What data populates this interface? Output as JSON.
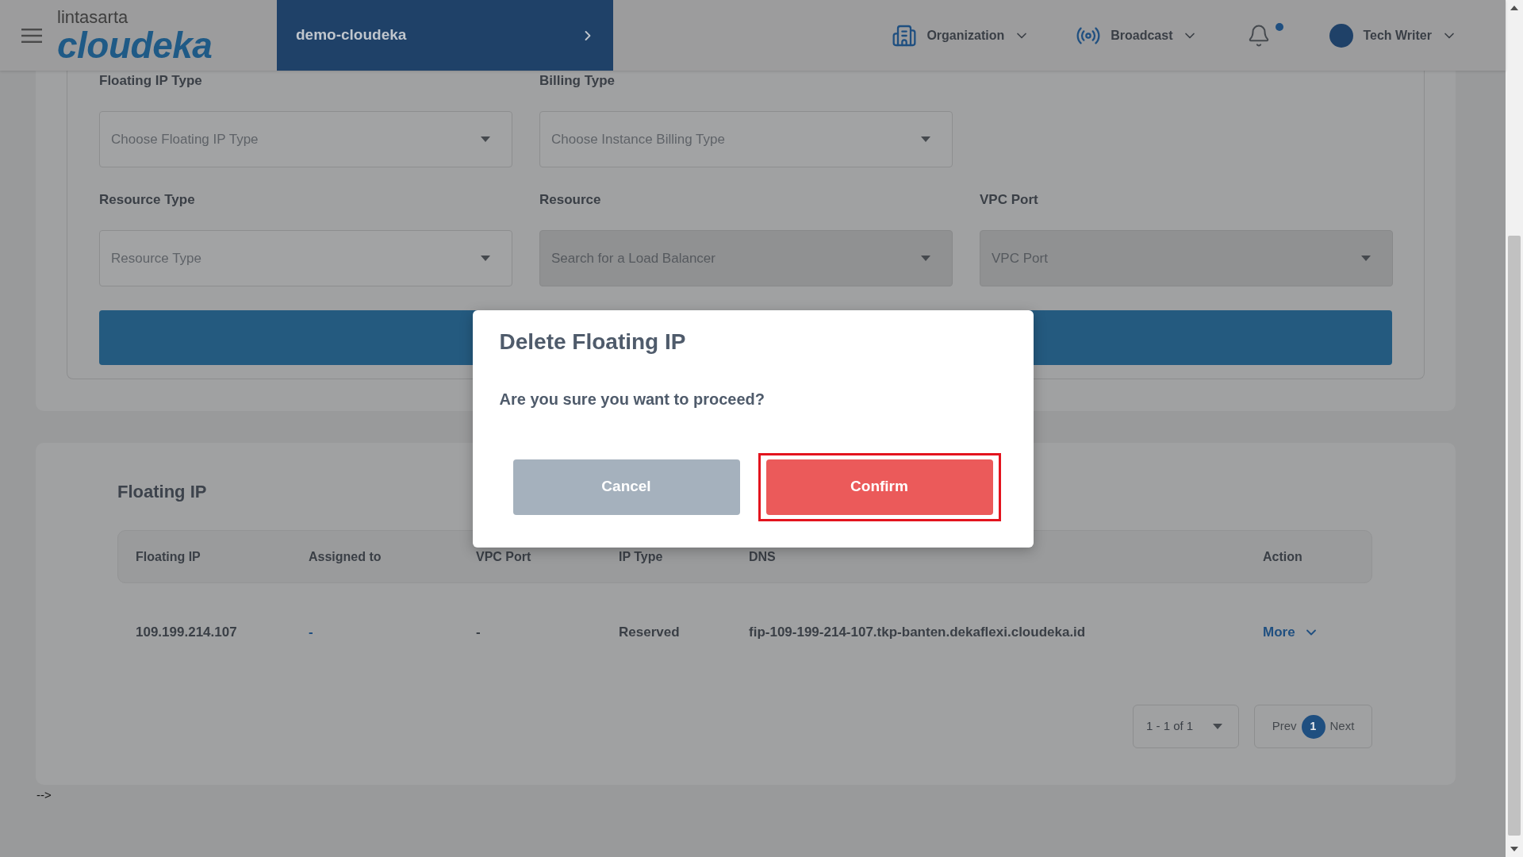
{
  "header": {
    "logo": {
      "company": "lintasarta",
      "product": "cloudeka"
    },
    "project": "demo-cloudeka",
    "menus": [
      {
        "kind": "organization",
        "label": "Organization"
      },
      {
        "kind": "broadcast",
        "label": "Broadcast"
      }
    ],
    "notifications": {
      "unread": true
    },
    "user": {
      "name": "Tech Writer"
    }
  },
  "filter_form": {
    "rows": [
      [
        {
          "label": "Floating IP Type",
          "placeholder": "Choose Floating IP Type",
          "disabled": false
        },
        {
          "label": "Billing Type",
          "placeholder": "Choose Instance Billing Type",
          "disabled": false
        }
      ],
      [
        {
          "label": "Resource Type",
          "placeholder": "Resource Type",
          "disabled": false
        },
        {
          "label": "Resource",
          "placeholder": "Search for a Load Balancer",
          "disabled": true
        },
        {
          "label": "VPC Port",
          "placeholder": "VPC Port",
          "disabled": true
        }
      ]
    ]
  },
  "floating_ip": {
    "title": "Floating IP",
    "table": {
      "columns": [
        "Floating IP",
        "Assigned to",
        "VPC Port",
        "IP Type",
        "DNS",
        "Action"
      ],
      "rows": [
        {
          "cells": [
            {
              "kind": "text",
              "text": "109.199.214.107"
            },
            {
              "kind": "link",
              "text": "-"
            },
            {
              "kind": "text",
              "text": "-"
            },
            {
              "kind": "text",
              "text": "Reserved"
            },
            {
              "kind": "text",
              "text": "fip-109-199-214-107.tkp-banten.dekaflexi.cloudeka.id"
            },
            {
              "kind": "menu",
              "text": "More"
            }
          ]
        }
      ]
    },
    "pagination": {
      "range": "1 - 1 of 1",
      "prev": "Prev",
      "pages": [
        {
          "label": "1",
          "selected": true
        }
      ],
      "next": "Next"
    }
  },
  "stray_text": "-->",
  "dialog": {
    "title": "Delete Floating IP",
    "message": "Are you sure you want to proceed?",
    "buttons": [
      {
        "kind": "cancel",
        "label": "Cancel",
        "highlighted": false
      },
      {
        "kind": "confirm",
        "label": "Confirm",
        "highlighted": true
      }
    ]
  }
}
